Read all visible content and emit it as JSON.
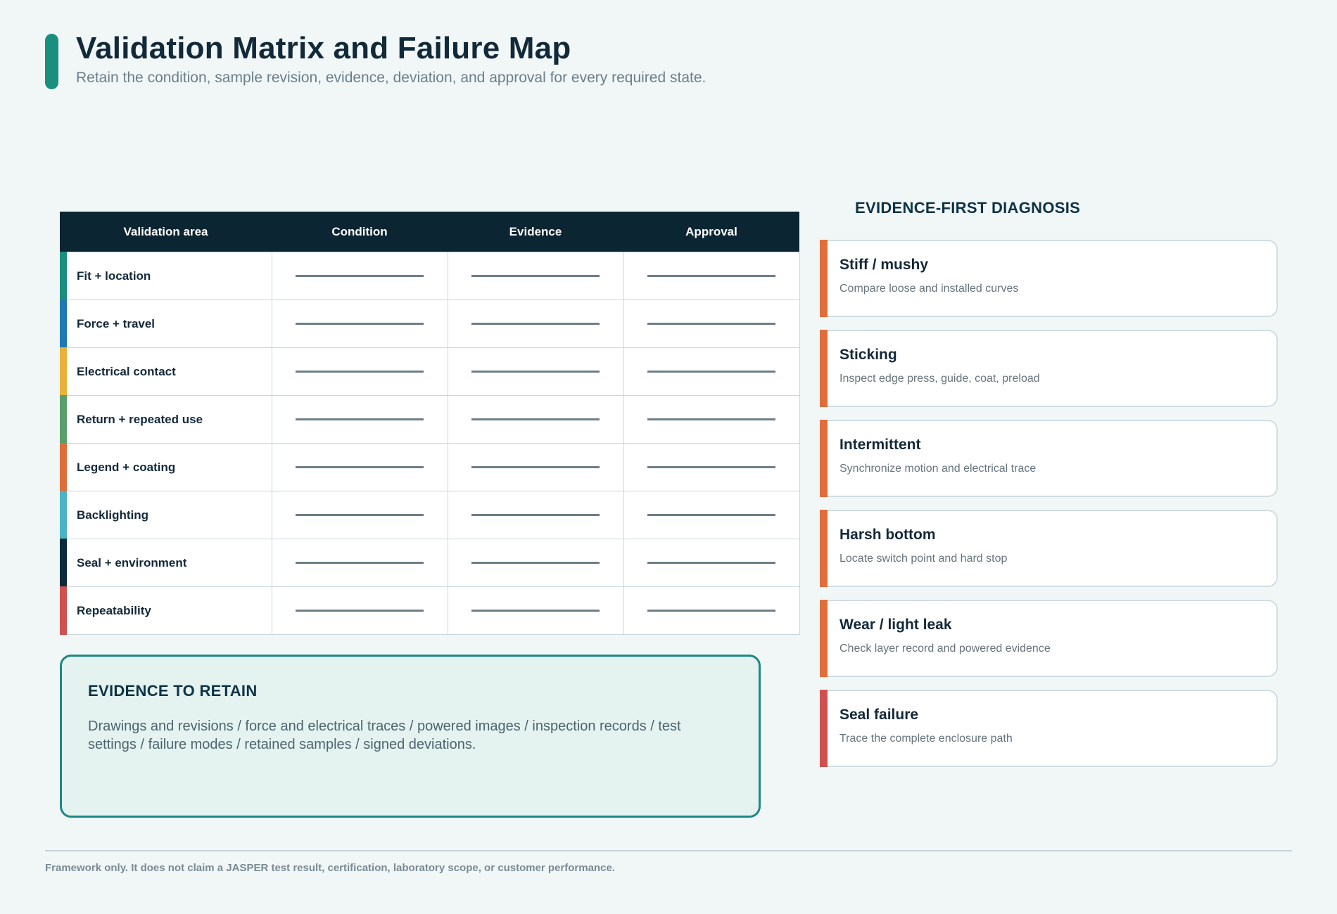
{
  "header": {
    "title": "Validation Matrix and Failure Map",
    "subtitle": "Retain the condition, sample revision, evidence, deviation, and approval for every required state."
  },
  "matrix": {
    "columns": [
      "Validation area",
      "Condition",
      "Evidence",
      "Approval"
    ],
    "rows": [
      {
        "area": "Fit + location",
        "color": "#1a8f80"
      },
      {
        "area": "Force + travel",
        "color": "#1f78b4"
      },
      {
        "area": "Electrical contact",
        "color": "#e8b23a"
      },
      {
        "area": "Return + repeated use",
        "color": "#5a9e6a"
      },
      {
        "area": "Legend + coating",
        "color": "#e06e3a"
      },
      {
        "area": "Backlighting",
        "color": "#4ab3c6"
      },
      {
        "area": "Seal + environment",
        "color": "#0c2a3a"
      },
      {
        "area": "Repeatability",
        "color": "#d05050"
      }
    ]
  },
  "evidence": {
    "heading": "EVIDENCE TO RETAIN",
    "text": "Drawings and revisions / force and electrical traces / powered images / inspection records / test settings / failure modes / retained samples / signed deviations."
  },
  "diagnosis": {
    "heading": "EVIDENCE-FIRST DIAGNOSIS",
    "items": [
      {
        "title": "Stiff / mushy",
        "desc": "Compare loose and installed curves",
        "color": "#e06e3a"
      },
      {
        "title": "Sticking",
        "desc": "Inspect edge press, guide, coat, preload",
        "color": "#e06e3a"
      },
      {
        "title": "Intermittent",
        "desc": "Synchronize motion and electrical trace",
        "color": "#e06e3a"
      },
      {
        "title": "Harsh bottom",
        "desc": "Locate switch point and hard stop",
        "color": "#e06e3a"
      },
      {
        "title": "Wear / light leak",
        "desc": "Check layer record and powered evidence",
        "color": "#e06e3a"
      },
      {
        "title": "Seal failure",
        "desc": "Trace the complete enclosure path",
        "color": "#d05050"
      }
    ]
  },
  "footer": {
    "note": "Framework only. It does not claim a JASPER test result, certification, laboratory scope, or customer performance."
  }
}
